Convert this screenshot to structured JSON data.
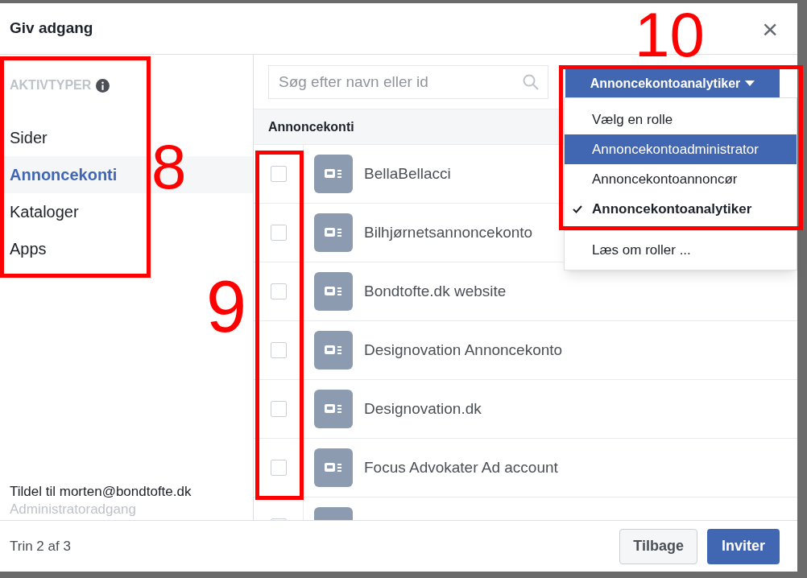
{
  "dialog": {
    "title": "Giv adgang",
    "close": "×"
  },
  "sidebar": {
    "heading": "AKTIVTYPER",
    "items": [
      {
        "label": "Sider",
        "selected": false
      },
      {
        "label": "Annoncekonti",
        "selected": true
      },
      {
        "label": "Kataloger",
        "selected": false
      },
      {
        "label": "Apps",
        "selected": false
      }
    ],
    "assignee": "Tildel til morten@bondtofte.dk",
    "access": "Administratoradgang"
  },
  "search": {
    "placeholder": "Søg efter navn eller id"
  },
  "role_dropdown": {
    "value": "Annoncekontoanalytiker",
    "expanded": true,
    "options": [
      {
        "label": "Vælg en rolle",
        "selected": false,
        "highlighted": false
      },
      {
        "label": "Annoncekontoadministrator",
        "selected": false,
        "highlighted": true
      },
      {
        "label": "Annoncekontoannoncør",
        "selected": false,
        "highlighted": false
      },
      {
        "label": "Annoncekontoanalytiker",
        "selected": true,
        "highlighted": false
      }
    ],
    "link": "Læs om roller ..."
  },
  "table": {
    "heading": "Annoncekonti",
    "rows": [
      {
        "name": "BellaBellacci",
        "checked": false
      },
      {
        "name": "Bilhjørnetsannoncekonto",
        "checked": false
      },
      {
        "name": "Bondtofte.dk website",
        "checked": false
      },
      {
        "name": "Designovation Annoncekonto",
        "checked": false
      },
      {
        "name": "Designovation.dk",
        "checked": false
      },
      {
        "name": "Focus Advokater Ad account",
        "checked": false
      },
      {
        "checked": false
      }
    ]
  },
  "footer": {
    "step": "Trin 2 af 3",
    "back": "Tilbage",
    "invite": "Inviter"
  },
  "annotations": [
    {
      "label": "8"
    },
    {
      "label": "9"
    },
    {
      "label": "10"
    }
  ]
}
